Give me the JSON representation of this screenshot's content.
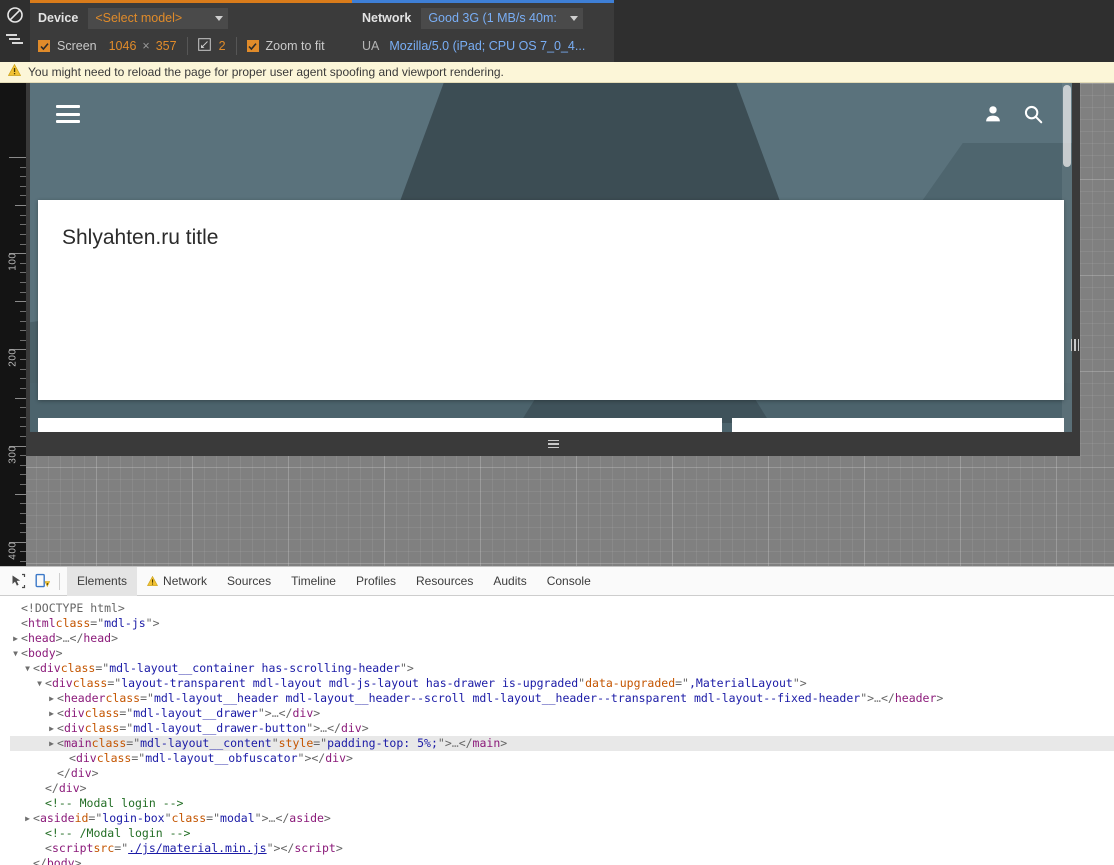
{
  "device_toolbar": {
    "left_rail": [
      {
        "name": "no-override-icon",
        "label": "Disable overrides"
      },
      {
        "name": "network-conditions-icon",
        "label": "Network conditions"
      }
    ],
    "device": {
      "section_label": "Device",
      "model_value": "<Select model>",
      "screen_checkbox_label": "Screen",
      "screen_checked": true,
      "screen_width": "1046",
      "screen_separator": "×",
      "screen_height": "357",
      "device_pixel_ratio": "2",
      "zoom_to_fit_label": "Zoom to fit",
      "zoom_to_fit_checked": true
    },
    "network": {
      "section_label": "Network",
      "throttling_value": "Good 3G (1 MB/s 40m:",
      "ua_label": "UA",
      "ua_value": "Mozilla/5.0 (iPad; CPU OS 7_0_4..."
    }
  },
  "warning": {
    "icon": "warning-triangle-icon",
    "text": "You might need to reload the page for proper user agent spoofing and viewport rendering."
  },
  "ruler": {
    "labels": [
      "100",
      "200",
      "300",
      "400"
    ]
  },
  "emulated_page": {
    "hamburger_icon": "hamburger-menu-icon",
    "actions": [
      {
        "name": "account-icon"
      },
      {
        "name": "search-icon"
      }
    ],
    "card_title": "Shlyahten.ru title",
    "colors": {
      "header_bg": "#5a727c",
      "header_dark": "#3c4d54",
      "card_bg": "#ffffff"
    }
  },
  "devtools": {
    "tools": [
      {
        "name": "inspect-element-icon"
      },
      {
        "name": "device-mode-icon"
      }
    ],
    "tabs": [
      {
        "label": "Elements",
        "active": true,
        "icon": null
      },
      {
        "label": "Network",
        "active": false,
        "icon": "warning-triangle-icon"
      },
      {
        "label": "Sources",
        "active": false,
        "icon": null
      },
      {
        "label": "Timeline",
        "active": false,
        "icon": null
      },
      {
        "label": "Profiles",
        "active": false,
        "icon": null
      },
      {
        "label": "Resources",
        "active": false,
        "icon": null
      },
      {
        "label": "Audits",
        "active": false,
        "icon": null
      },
      {
        "label": "Console",
        "active": false,
        "icon": null
      }
    ],
    "dom_lines": [
      {
        "indent": 0,
        "twisty": "",
        "selected": false,
        "parts": [
          {
            "t": "pun",
            "v": "<!DOCTYPE html>"
          }
        ]
      },
      {
        "indent": 0,
        "twisty": "",
        "selected": false,
        "parts": [
          {
            "t": "pun",
            "v": "<"
          },
          {
            "t": "tag",
            "v": "html"
          },
          {
            "t": "pun",
            "v": " "
          },
          {
            "t": "attr",
            "v": "class"
          },
          {
            "t": "pun",
            "v": "=\""
          },
          {
            "t": "val",
            "v": "mdl-js"
          },
          {
            "t": "pun",
            "v": "\">"
          }
        ]
      },
      {
        "indent": 0,
        "twisty": "▶",
        "selected": false,
        "parts": [
          {
            "t": "pun",
            "v": "<"
          },
          {
            "t": "tag",
            "v": "head"
          },
          {
            "t": "pun",
            "v": ">"
          },
          {
            "t": "dots",
            "v": "…"
          },
          {
            "t": "pun",
            "v": "</"
          },
          {
            "t": "tag",
            "v": "head"
          },
          {
            "t": "pun",
            "v": ">"
          }
        ]
      },
      {
        "indent": 0,
        "twisty": "▼",
        "selected": false,
        "parts": [
          {
            "t": "pun",
            "v": "<"
          },
          {
            "t": "tag",
            "v": "body"
          },
          {
            "t": "pun",
            "v": ">"
          }
        ]
      },
      {
        "indent": 1,
        "twisty": "▼",
        "selected": false,
        "parts": [
          {
            "t": "pun",
            "v": "<"
          },
          {
            "t": "tag",
            "v": "div"
          },
          {
            "t": "pun",
            "v": " "
          },
          {
            "t": "attr",
            "v": "class"
          },
          {
            "t": "pun",
            "v": "=\""
          },
          {
            "t": "val",
            "v": "mdl-layout__container has-scrolling-header"
          },
          {
            "t": "pun",
            "v": "\">"
          }
        ]
      },
      {
        "indent": 2,
        "twisty": "▼",
        "selected": false,
        "parts": [
          {
            "t": "pun",
            "v": "<"
          },
          {
            "t": "tag",
            "v": "div"
          },
          {
            "t": "pun",
            "v": " "
          },
          {
            "t": "attr",
            "v": "class"
          },
          {
            "t": "pun",
            "v": "=\""
          },
          {
            "t": "val",
            "v": "layout-transparent mdl-layout mdl-js-layout has-drawer is-upgraded"
          },
          {
            "t": "pun",
            "v": "\" "
          },
          {
            "t": "attr",
            "v": "data-upgraded"
          },
          {
            "t": "pun",
            "v": "=\""
          },
          {
            "t": "val",
            "v": ",MaterialLayout"
          },
          {
            "t": "pun",
            "v": "\">"
          }
        ]
      },
      {
        "indent": 3,
        "twisty": "▶",
        "selected": false,
        "parts": [
          {
            "t": "pun",
            "v": "<"
          },
          {
            "t": "tag",
            "v": "header"
          },
          {
            "t": "pun",
            "v": " "
          },
          {
            "t": "attr",
            "v": "class"
          },
          {
            "t": "pun",
            "v": "=\""
          },
          {
            "t": "val",
            "v": "mdl-layout__header mdl-layout__header--scroll mdl-layout__header--transparent mdl-layout--fixed-header"
          },
          {
            "t": "pun",
            "v": "\">"
          },
          {
            "t": "dots",
            "v": "…"
          },
          {
            "t": "pun",
            "v": "</"
          },
          {
            "t": "tag",
            "v": "header"
          },
          {
            "t": "pun",
            "v": ">"
          }
        ]
      },
      {
        "indent": 3,
        "twisty": "▶",
        "selected": false,
        "parts": [
          {
            "t": "pun",
            "v": "<"
          },
          {
            "t": "tag",
            "v": "div"
          },
          {
            "t": "pun",
            "v": " "
          },
          {
            "t": "attr",
            "v": "class"
          },
          {
            "t": "pun",
            "v": "=\""
          },
          {
            "t": "val",
            "v": "mdl-layout__drawer"
          },
          {
            "t": "pun",
            "v": "\">"
          },
          {
            "t": "dots",
            "v": "…"
          },
          {
            "t": "pun",
            "v": "</"
          },
          {
            "t": "tag",
            "v": "div"
          },
          {
            "t": "pun",
            "v": ">"
          }
        ]
      },
      {
        "indent": 3,
        "twisty": "▶",
        "selected": false,
        "parts": [
          {
            "t": "pun",
            "v": "<"
          },
          {
            "t": "tag",
            "v": "div"
          },
          {
            "t": "pun",
            "v": " "
          },
          {
            "t": "attr",
            "v": "class"
          },
          {
            "t": "pun",
            "v": "=\""
          },
          {
            "t": "val",
            "v": "mdl-layout__drawer-button"
          },
          {
            "t": "pun",
            "v": "\">"
          },
          {
            "t": "dots",
            "v": "…"
          },
          {
            "t": "pun",
            "v": "</"
          },
          {
            "t": "tag",
            "v": "div"
          },
          {
            "t": "pun",
            "v": ">"
          }
        ]
      },
      {
        "indent": 3,
        "twisty": "▶",
        "selected": true,
        "parts": [
          {
            "t": "pun",
            "v": "<"
          },
          {
            "t": "tag",
            "v": "main"
          },
          {
            "t": "pun",
            "v": " "
          },
          {
            "t": "attr",
            "v": "class"
          },
          {
            "t": "pun",
            "v": "=\""
          },
          {
            "t": "val",
            "v": "mdl-layout__content"
          },
          {
            "t": "pun",
            "v": "\" "
          },
          {
            "t": "attr",
            "v": "style"
          },
          {
            "t": "pun",
            "v": "=\""
          },
          {
            "t": "val",
            "v": "padding-top: 5%;"
          },
          {
            "t": "pun",
            "v": "\">"
          },
          {
            "t": "dots",
            "v": "…"
          },
          {
            "t": "pun",
            "v": "</"
          },
          {
            "t": "tag",
            "v": "main"
          },
          {
            "t": "pun",
            "v": ">"
          }
        ]
      },
      {
        "indent": 4,
        "twisty": "",
        "selected": false,
        "parts": [
          {
            "t": "pun",
            "v": "<"
          },
          {
            "t": "tag",
            "v": "div"
          },
          {
            "t": "pun",
            "v": " "
          },
          {
            "t": "attr",
            "v": "class"
          },
          {
            "t": "pun",
            "v": "=\""
          },
          {
            "t": "val",
            "v": "mdl-layout__obfuscator"
          },
          {
            "t": "pun",
            "v": "\"></"
          },
          {
            "t": "tag",
            "v": "div"
          },
          {
            "t": "pun",
            "v": ">"
          }
        ]
      },
      {
        "indent": 3,
        "twisty": "",
        "selected": false,
        "parts": [
          {
            "t": "pun",
            "v": "</"
          },
          {
            "t": "tag",
            "v": "div"
          },
          {
            "t": "pun",
            "v": ">"
          }
        ]
      },
      {
        "indent": 2,
        "twisty": "",
        "selected": false,
        "parts": [
          {
            "t": "pun",
            "v": "</"
          },
          {
            "t": "tag",
            "v": "div"
          },
          {
            "t": "pun",
            "v": ">"
          }
        ]
      },
      {
        "indent": 2,
        "twisty": "",
        "selected": false,
        "parts": [
          {
            "t": "com",
            "v": "<!-- Modal login  -->"
          }
        ]
      },
      {
        "indent": 1,
        "twisty": "▶",
        "selected": false,
        "parts": [
          {
            "t": "pun",
            "v": "<"
          },
          {
            "t": "tag",
            "v": "aside"
          },
          {
            "t": "pun",
            "v": " "
          },
          {
            "t": "attr",
            "v": "id"
          },
          {
            "t": "pun",
            "v": "=\""
          },
          {
            "t": "val",
            "v": "login-box"
          },
          {
            "t": "pun",
            "v": "\" "
          },
          {
            "t": "attr",
            "v": "class"
          },
          {
            "t": "pun",
            "v": "=\""
          },
          {
            "t": "val",
            "v": "modal"
          },
          {
            "t": "pun",
            "v": "\">"
          },
          {
            "t": "dots",
            "v": "…"
          },
          {
            "t": "pun",
            "v": "</"
          },
          {
            "t": "tag",
            "v": "aside"
          },
          {
            "t": "pun",
            "v": ">"
          }
        ]
      },
      {
        "indent": 2,
        "twisty": "",
        "selected": false,
        "parts": [
          {
            "t": "com",
            "v": "<!-- /Modal login -->"
          }
        ]
      },
      {
        "indent": 2,
        "twisty": "",
        "selected": false,
        "parts": [
          {
            "t": "pun",
            "v": "<"
          },
          {
            "t": "tag",
            "v": "script"
          },
          {
            "t": "pun",
            "v": " "
          },
          {
            "t": "attr",
            "v": "src"
          },
          {
            "t": "pun",
            "v": "=\""
          },
          {
            "t": "lnk",
            "v": "./js/material.min.js"
          },
          {
            "t": "pun",
            "v": "\"></"
          },
          {
            "t": "tag",
            "v": "script"
          },
          {
            "t": "pun",
            "v": ">"
          }
        ]
      },
      {
        "indent": 1,
        "twisty": "",
        "selected": false,
        "parts": [
          {
            "t": "pun",
            "v": "</"
          },
          {
            "t": "tag",
            "v": "body"
          },
          {
            "t": "pun",
            "v": ">"
          }
        ]
      }
    ]
  }
}
